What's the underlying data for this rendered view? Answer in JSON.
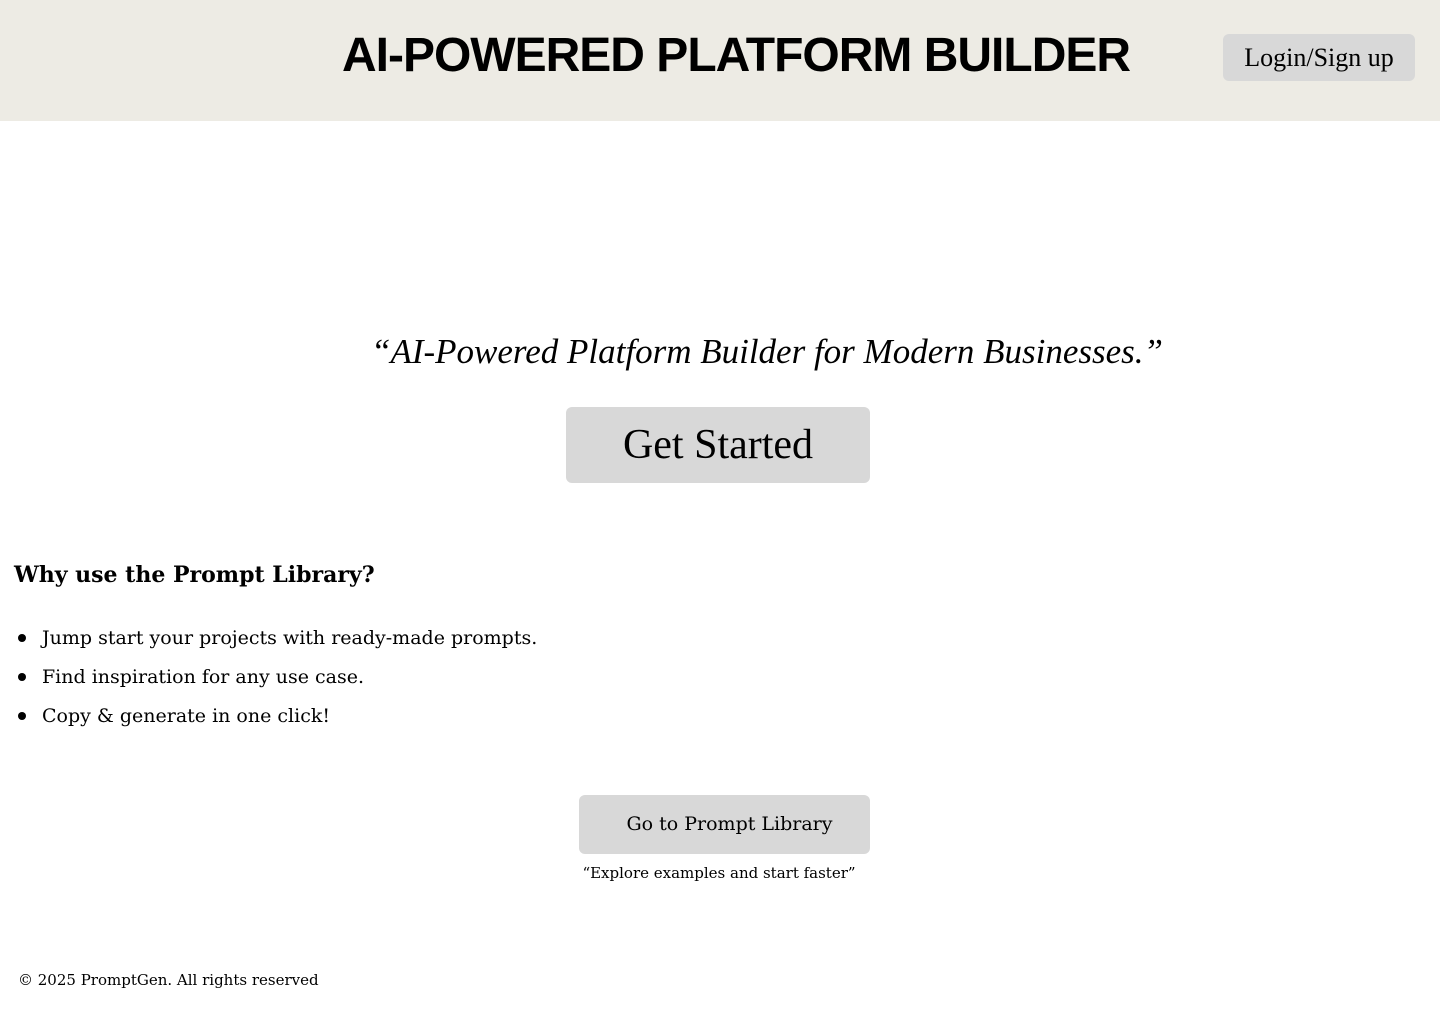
{
  "header": {
    "title": "AI-POWERED PLATFORM BUILDER",
    "login_label": "Login/Sign up",
    "background_color": "#edebe4"
  },
  "hero": {
    "tagline": "“AI-Powered Platform Builder for Modern Businesses.”",
    "cta_label": "Get Started"
  },
  "library_section": {
    "heading": "Why use the Prompt Library?",
    "benefits": [
      "Jump start your projects with ready-made prompts.",
      "Find inspiration for any use case.",
      "Copy & generate in one click!"
    ],
    "button_label": "Go to Prompt Library",
    "caption": "“Explore examples and start faster”"
  },
  "footer": {
    "copyright": "© 2025 PromptGen. All rights reserved"
  },
  "colors": {
    "button_bg": "#d8d8d8",
    "header_bg": "#edebe4",
    "text": "#000000"
  }
}
